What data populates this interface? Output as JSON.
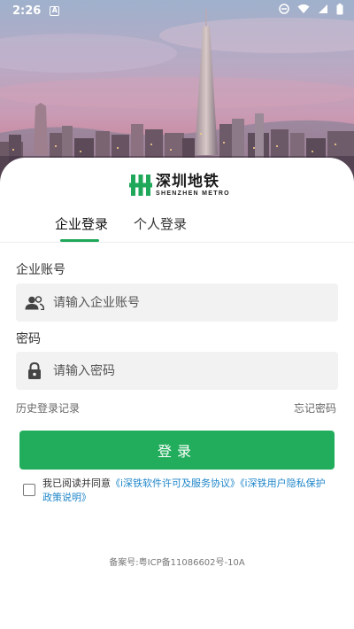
{
  "status_bar": {
    "time": "2:26",
    "notification_glyph": "A",
    "icons": [
      "do-not-disturb-icon",
      "wifi-icon",
      "signal-icon",
      "battery-icon"
    ]
  },
  "brand": {
    "name_cn": "深圳地铁",
    "name_en": "SHENZHEN METRO",
    "color": "#1fa85a"
  },
  "tabs": [
    {
      "label": "企业登录",
      "active": true
    },
    {
      "label": "个人登录",
      "active": false
    }
  ],
  "form": {
    "account_label": "企业账号",
    "account_placeholder": "请输入企业账号",
    "account_icon": "users-icon",
    "password_label": "密码",
    "password_placeholder": "请输入密码",
    "password_icon": "lock-icon"
  },
  "links": {
    "history": "历史登录记录",
    "forgot": "忘记密码"
  },
  "login_button": {
    "label": "登录",
    "color": "#22ad5c"
  },
  "agreement": {
    "checked": false,
    "prefix": "我已阅读并同意",
    "link1": "《i深铁软件许可及服务协议》",
    "link2": "《i深铁用户隐私保护政策说明》",
    "link_color": "#1f86c9"
  },
  "footer": {
    "icp": "备案号:粤ICP备11086602号-10A"
  }
}
